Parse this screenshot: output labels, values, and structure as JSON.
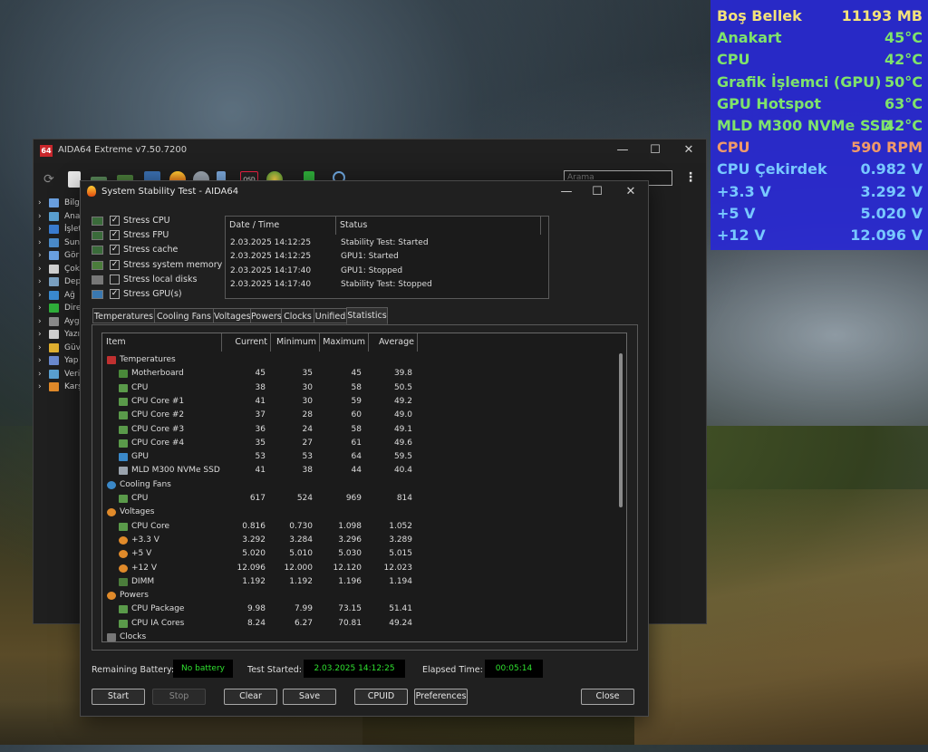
{
  "osd": {
    "rows": [
      {
        "label": "Boş Bellek",
        "value": "11193 MB",
        "color": "#f3e27a"
      },
      {
        "label": "Anakart",
        "value": "45°C",
        "color": "#7fe36b"
      },
      {
        "label": "CPU",
        "value": "42°C",
        "color": "#7fe36b"
      },
      {
        "label": "Grafik İşlemci (GPU)",
        "value": "50°C",
        "color": "#7fe36b"
      },
      {
        "label": "GPU Hotspot",
        "value": "63°C",
        "color": "#7fe36b"
      },
      {
        "label": "MLD M300 NVMe SSD",
        "value": "42°C",
        "color": "#7fe36b"
      },
      {
        "label": "CPU",
        "value": "590 RPM",
        "color": "#f09a6a"
      },
      {
        "label": "CPU Çekirdek",
        "value": "0.982 V",
        "color": "#78c8ff"
      },
      {
        "label": "+3.3 V",
        "value": "3.292 V",
        "color": "#78c8ff"
      },
      {
        "label": "+5 V",
        "value": "5.020 V",
        "color": "#78c8ff"
      },
      {
        "label": "+12 V",
        "value": "12.096 V",
        "color": "#78c8ff"
      }
    ]
  },
  "main_window": {
    "app_icon": "64",
    "title": "AIDA64 Extreme v7.50.7200",
    "search_placeholder": "Arama",
    "tree": [
      "Bilg",
      "Ana",
      "İşlet",
      "Sun",
      "Gör",
      "Çok",
      "Dep",
      "Ağ",
      "Dire",
      "Ayg",
      "Yazı",
      "Güv",
      "Yap",
      "Veri",
      "Karş"
    ]
  },
  "dialog": {
    "title": "System Stability Test - AIDA64",
    "stress": [
      {
        "label": "Stress CPU",
        "checked": true
      },
      {
        "label": "Stress FPU",
        "checked": true
      },
      {
        "label": "Stress cache",
        "checked": true
      },
      {
        "label": "Stress system memory",
        "checked": true
      },
      {
        "label": "Stress local disks",
        "checked": false
      },
      {
        "label": "Stress GPU(s)",
        "checked": true
      }
    ],
    "log_headers": {
      "date": "Date / Time",
      "status": "Status"
    },
    "log": [
      {
        "date": "2.03.2025 14:12:25",
        "status": "Stability Test: Started"
      },
      {
        "date": "2.03.2025 14:12:25",
        "status": "GPU1: Started"
      },
      {
        "date": "2.03.2025 14:17:40",
        "status": "GPU1: Stopped"
      },
      {
        "date": "2.03.2025 14:17:40",
        "status": "Stability Test: Stopped"
      }
    ],
    "tabs": [
      "Temperatures",
      "Cooling Fans",
      "Voltages",
      "Powers",
      "Clocks",
      "Unified",
      "Statistics"
    ],
    "active_tab": "Statistics",
    "grid_headers": {
      "item": "Item",
      "current": "Current",
      "minimum": "Minimum",
      "maximum": "Maximum",
      "average": "Average"
    },
    "rows": [
      {
        "type": "group",
        "name": "Temperatures",
        "icon": "thermometer-icon"
      },
      {
        "type": "item",
        "name": "Motherboard",
        "icon": "motherboard-icon",
        "cur": "45",
        "min": "35",
        "max": "45",
        "avg": "39.8"
      },
      {
        "type": "item",
        "name": "CPU",
        "icon": "chip-icon",
        "cur": "38",
        "min": "30",
        "max": "58",
        "avg": "50.5"
      },
      {
        "type": "item",
        "name": "CPU Core #1",
        "icon": "chip-icon",
        "cur": "41",
        "min": "30",
        "max": "59",
        "avg": "49.2"
      },
      {
        "type": "item",
        "name": "CPU Core #2",
        "icon": "chip-icon",
        "cur": "37",
        "min": "28",
        "max": "60",
        "avg": "49.0"
      },
      {
        "type": "item",
        "name": "CPU Core #3",
        "icon": "chip-icon",
        "cur": "36",
        "min": "24",
        "max": "58",
        "avg": "49.1"
      },
      {
        "type": "item",
        "name": "CPU Core #4",
        "icon": "chip-icon",
        "cur": "35",
        "min": "27",
        "max": "61",
        "avg": "49.6"
      },
      {
        "type": "item",
        "name": "GPU",
        "icon": "gpu-icon",
        "cur": "53",
        "min": "53",
        "max": "64",
        "avg": "59.5"
      },
      {
        "type": "item",
        "name": "MLD M300 NVMe SSD",
        "icon": "drive-icon",
        "cur": "41",
        "min": "38",
        "max": "44",
        "avg": "40.4"
      },
      {
        "type": "group",
        "name": "Cooling Fans",
        "icon": "fan-icon"
      },
      {
        "type": "item",
        "name": "CPU",
        "icon": "chip-icon",
        "cur": "617",
        "min": "524",
        "max": "969",
        "avg": "814"
      },
      {
        "type": "group",
        "name": "Voltages",
        "icon": "voltage-icon"
      },
      {
        "type": "item",
        "name": "CPU Core",
        "icon": "chip-icon",
        "cur": "0.816",
        "min": "0.730",
        "max": "1.098",
        "avg": "1.052"
      },
      {
        "type": "item",
        "name": "+3.3 V",
        "icon": "voltage-icon",
        "cur": "3.292",
        "min": "3.284",
        "max": "3.296",
        "avg": "3.289"
      },
      {
        "type": "item",
        "name": "+5 V",
        "icon": "voltage-icon",
        "cur": "5.020",
        "min": "5.010",
        "max": "5.030",
        "avg": "5.015"
      },
      {
        "type": "item",
        "name": "+12 V",
        "icon": "voltage-icon",
        "cur": "12.096",
        "min": "12.000",
        "max": "12.120",
        "avg": "12.023"
      },
      {
        "type": "item",
        "name": "DIMM",
        "icon": "memory-icon",
        "cur": "1.192",
        "min": "1.192",
        "max": "1.196",
        "avg": "1.194"
      },
      {
        "type": "group",
        "name": "Powers",
        "icon": "voltage-icon"
      },
      {
        "type": "item",
        "name": "CPU Package",
        "icon": "chip-icon",
        "cur": "9.98",
        "min": "7.99",
        "max": "73.15",
        "avg": "51.41"
      },
      {
        "type": "item",
        "name": "CPU IA Cores",
        "icon": "chip-icon",
        "cur": "8.24",
        "min": "6.27",
        "max": "70.81",
        "avg": "49.24"
      },
      {
        "type": "group",
        "name": "Clocks",
        "icon": "clock-icon"
      }
    ],
    "status": {
      "battery_label": "Remaining Battery:",
      "battery_value": "No battery",
      "started_label": "Test Started:",
      "started_value": "2.03.2025 14:12:25",
      "elapsed_label": "Elapsed Time:",
      "elapsed_value": "00:05:14"
    },
    "buttons": {
      "start": "Start",
      "stop": "Stop",
      "clear": "Clear",
      "save": "Save",
      "cpuid": "CPUID",
      "preferences": "Preferences",
      "close": "Close"
    }
  }
}
